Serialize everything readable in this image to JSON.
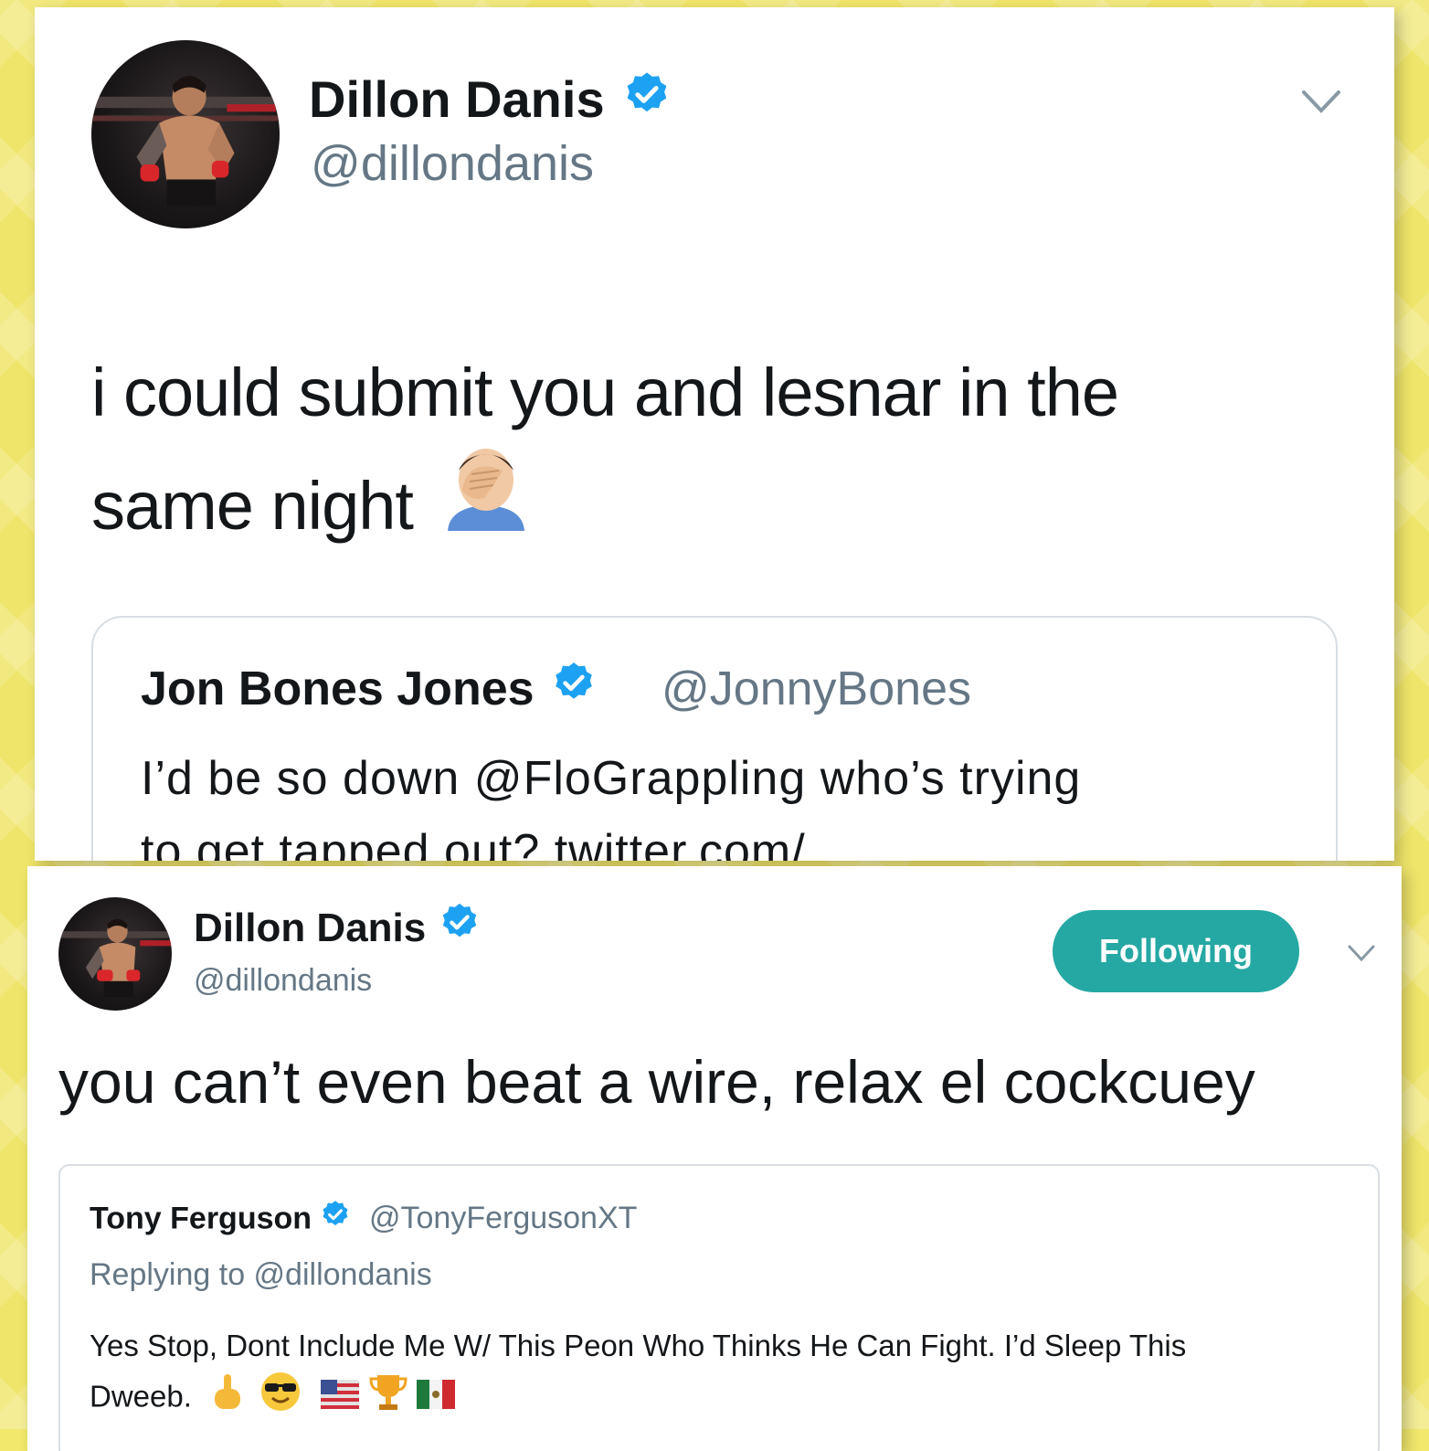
{
  "tweet1": {
    "name": "Dillon Danis",
    "handle": "@dillondanis",
    "text_line1": "i could submit you and lesnar in the",
    "text_line2": "same night",
    "text_emoji": "man-facepalming-emoji",
    "quote": {
      "name": "Jon Bones Jones",
      "handle": "@JonnyBones",
      "text_line1": "I’d be so down @FloGrappling who’s trying",
      "text_line2": "to get tapped out? twitter.com/"
    }
  },
  "tweet2": {
    "name": "Dillon Danis",
    "handle": "@dillondanis",
    "follow_label": "Following",
    "text": "you can’t even beat a wire, relax el cockcuey",
    "quote": {
      "name": "Tony Ferguson",
      "handle": "@TonyFergusonXT",
      "replying": "Replying to @dillondanis",
      "text_line1": "Yes Stop, Dont Include Me W/ This Peon Who Thinks He Can Fight. I’d Sleep This",
      "text_line2": "Dweeb.",
      "emojis": [
        "pointing-up-emoji",
        "sunglasses-emoji",
        "us-flag-emoji",
        "trophy-emoji",
        "mexico-flag-emoji"
      ]
    }
  },
  "colors": {
    "background": "#f1e86c",
    "verified": "#1da1f2",
    "follow_button": "#25a8a3",
    "handle": "#657786"
  }
}
